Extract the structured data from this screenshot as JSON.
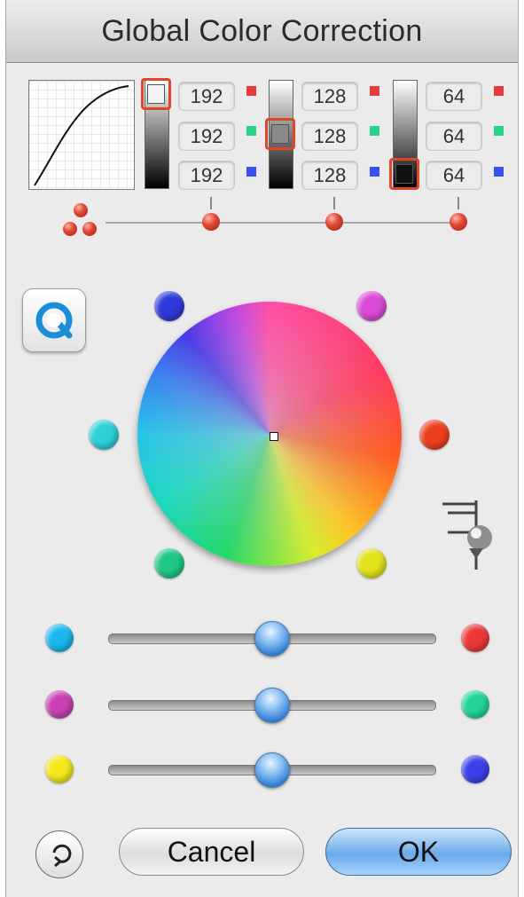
{
  "window": {
    "title": "Global Color Correction"
  },
  "levels": [
    {
      "id": "highlights",
      "values": [
        "192",
        "192",
        "192"
      ]
    },
    {
      "id": "midtones",
      "values": [
        "128",
        "128",
        "128"
      ]
    },
    {
      "id": "shadows",
      "values": [
        "64",
        "64",
        "64"
      ]
    }
  ],
  "channel_colors": {
    "red": "#e53b3b",
    "green": "#27d487",
    "blue": "#3a4ff0"
  },
  "wheel_dots": {
    "blue": "#2f3ad8",
    "magenta": "#d94ad6",
    "cyan": "#2fcfd8",
    "red": "#ee3f1e",
    "green": "#1fc884",
    "yellow": "#e3e31a"
  },
  "sliders": [
    {
      "left_color": "#1ab8ee",
      "right_color": "#ee3838",
      "value": 0.5
    },
    {
      "left_color": "#c941b5",
      "right_color": "#22d596",
      "value": 0.5
    },
    {
      "left_color": "#f4e81a",
      "right_color": "#3b40ea",
      "value": 0.5
    }
  ],
  "buttons": {
    "cancel": "Cancel",
    "ok": "OK"
  },
  "icons": {
    "tool": "aqua-circle-icon",
    "reset": "reset-icon",
    "eyedropper": "eyedropper-icon"
  }
}
